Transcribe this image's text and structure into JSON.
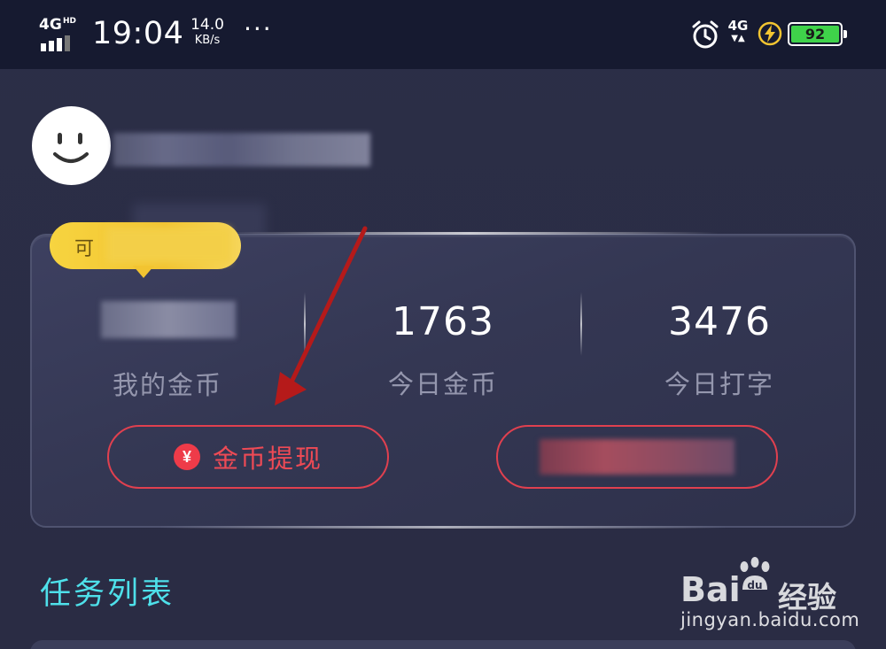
{
  "status_bar": {
    "network": "4G",
    "network_hd": "HD",
    "time": "19:04",
    "speed_value": "14.0",
    "speed_unit": "KB/s",
    "more": "···",
    "alarm_icon": "alarm-clock-icon",
    "mobile_data": "4G",
    "charging_icon": "lightning-icon",
    "battery_level": "92",
    "battery_color": "#3fd24a"
  },
  "profile": {
    "avatar_icon": "smiley-face-icon"
  },
  "card": {
    "tooltip_text": "可",
    "stats": [
      {
        "value": "",
        "label": "我的金币"
      },
      {
        "value": "1763",
        "label": "今日金币"
      },
      {
        "value": "3476",
        "label": "今日打字"
      }
    ],
    "withdraw_button": {
      "icon": "¥",
      "label": "金币提现"
    },
    "accent": "#e0404f"
  },
  "section": {
    "title": "任务列表",
    "title_color": "#4ee0ea"
  },
  "watermark": {
    "brand": "Bai",
    "brand_suffix": "经验",
    "site": "jingyan.baidu.com"
  }
}
